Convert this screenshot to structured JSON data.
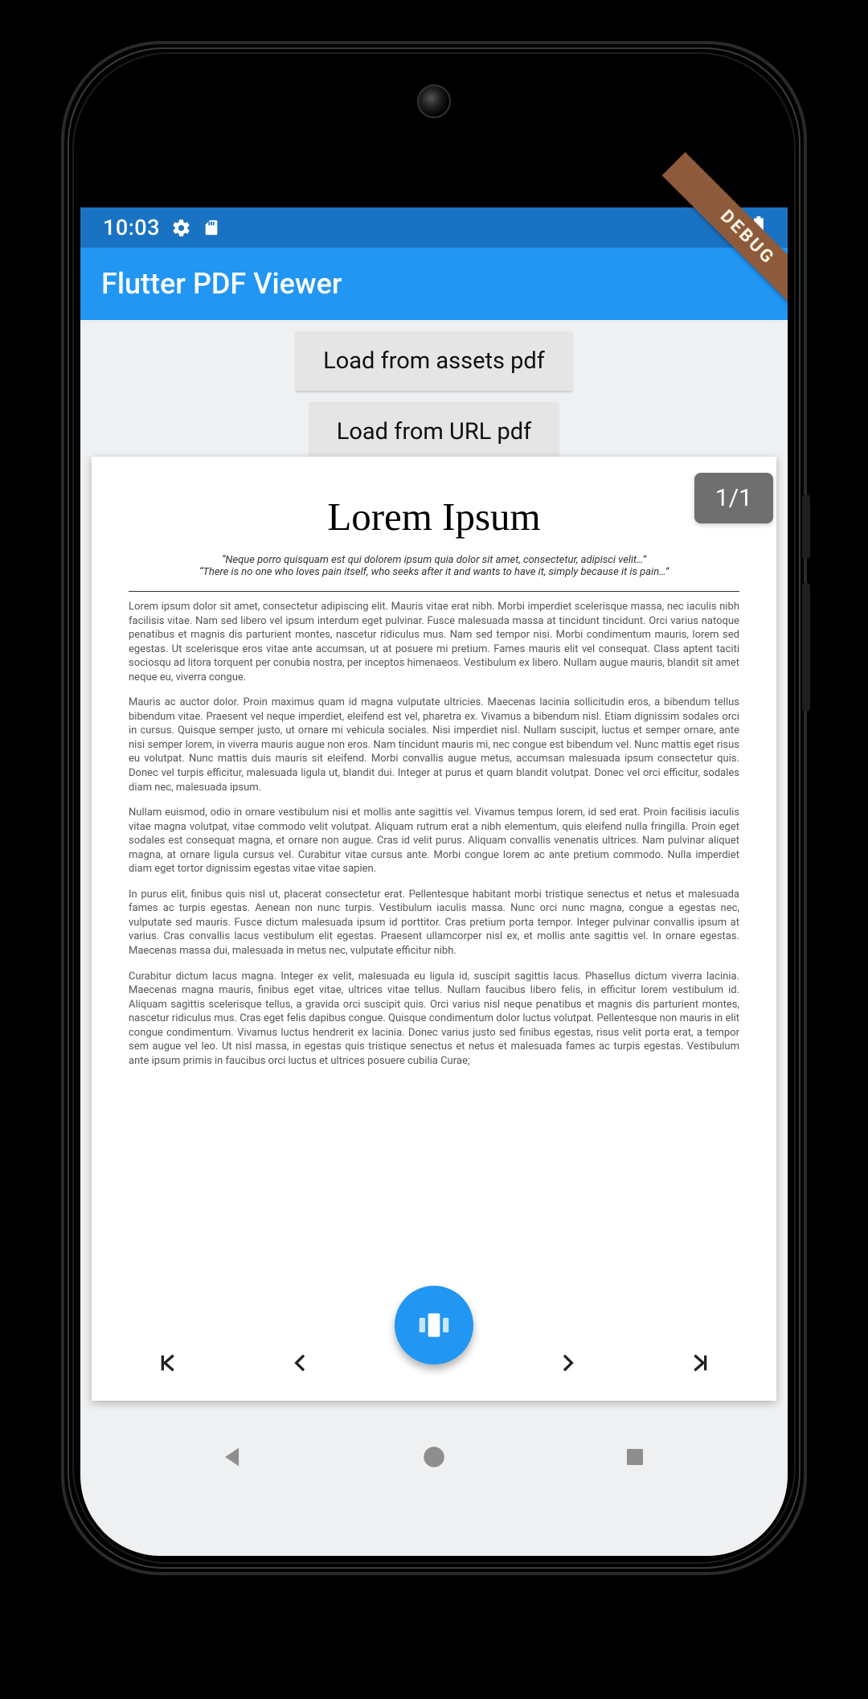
{
  "status": {
    "time": "10:03"
  },
  "appbar": {
    "title": "Flutter PDF Viewer"
  },
  "debug": {
    "label": "DEBUG"
  },
  "buttons": {
    "load_assets": "Load from assets pdf",
    "load_url": "Load from URL pdf"
  },
  "page_badge": "1/1",
  "pdf": {
    "title": "Lorem Ipsum",
    "quote1": "“Neque porro quisquam est qui dolorem ipsum quia dolor sit amet, consectetur, adipisci velit…”",
    "quote2": "“There is no one who loves pain itself, who seeks after it and wants to have it, simply because it is pain…”",
    "p1": "Lorem ipsum dolor sit amet, consectetur adipiscing elit. Mauris vitae erat nibh. Morbi imperdiet scelerisque massa, nec iaculis nibh facilisis vitae. Nam sed libero vel ipsum interdum eget pulvinar. Fusce malesuada massa at tincidunt tincidunt. Orci varius natoque penatibus et magnis dis parturient montes, nascetur ridiculus mus. Nam sed tempor nisi. Morbi condimentum mauris, lorem sed egestas. Ut scelerisque eros vitae ante accumsan, ut at posuere mi pretium. Fames mauris elit vel consequat. Class aptent taciti sociosqu ad litora torquent per conubia nostra, per inceptos himenaeos. Vestibulum ex libero. Nullam augue mauris, blandit sit amet neque eu, viverra congue.",
    "p2": "Mauris ac auctor dolor. Proin maximus quam id magna vulputate ultricies. Maecenas lacinia sollicitudin eros, a bibendum tellus bibendum vitae. Praesent vel neque imperdiet, eleifend est vel, pharetra ex. Vivamus a bibendum nisl. Etiam dignissim sodales orci in cursus. Quisque semper justo, ut ornare mi vehicula sociales. Nisi imperdiet nisl. Nullam suscipit, luctus et semper ornare, ante nisi semper lorem, in viverra mauris augue non eros. Nam tincidunt mauris mi, nec congue est bibendum vel. Nunc mattis eget risus eu volutpat. Nunc mattis duis mauris sit eleifend. Morbi convallis augue metus, accumsan malesuada ipsum consectetur quis. Donec vel turpis efficitur, malesuada ligula ut, blandit dui. Integer at purus et quam blandit volutpat. Donec vel orci efficitur, sodales diam nec, malesuada ipsum.",
    "p3": "Nullam euismod, odio in ornare vestibulum nisi et mollis ante sagittis vel. Vivamus tempus lorem, id sed erat. Proin facilisis iaculis vitae magna volutpat, vitae commodo velit volutpat. Aliquam rutrum erat a nibh elementum, quis eleifend nulla fringilla. Proin eget sodales est consequat magna, et ornare non augue. Cras id velit purus. Aliquam convallis venenatis ultrices. Nam pulvinar aliquet magna, at ornare ligula cursus vel. Curabitur vitae cursus ante. Morbi congue lorem ac ante pretium commodo. Nulla imperdiet diam eget tortor dignissim egestas vitae vitae sapien.",
    "p4": "In purus elit, finibus quis nisl ut, placerat consectetur erat. Pellentesque habitant morbi tristique senectus et netus et malesuada fames ac turpis egestas. Aenean non nunc turpis. Vestibulum iaculis massa. Nunc orci nunc magna, congue a egestas nec, vulputate sed mauris. Fusce dictum malesuada ipsum id porttitor. Cras pretium porta tempor. Integer pulvinar convallis ipsum at varius. Cras convallis lacus vestibulum elit egestas. Praesent ullamcorper nisl ex, et mollis ante sagittis vel. In ornare egestas. Maecenas massa dui, malesuada in metus nec, vulputate efficitur nibh.",
    "p5": "Curabitur dictum lacus magna. Integer ex velit, malesuada eu ligula id, suscipit sagittis lacus. Phasellus dictum viverra lacinia. Maecenas magna mauris, finibus eget vitae, ultrices vitae tellus. Nullam faucibus libero felis, in efficitur lorem vestibulum id. Aliquam sagittis scelerisque tellus, a gravida orci suscipit quis. Orci varius nisl neque penatibus et magnis dis parturient montes, nascetur ridiculus mus. Cras eget felis dapibus congue. Quisque condimentum dolor luctus volutpat. Pellentesque non mauris in elit congue condimentum. Vivamus luctus hendrerit ex lacinia. Donec varius justo sed finibus egestas, risus velit porta erat, a tempor sem augue vel leo. Ut nisl massa, in egestas quis tristique senectus et netus et malesuada fames ac turpis egestas. Vestibulum ante ipsum primis in faucibus orci luctus et ultrices posuere cubilia Curae;"
  }
}
